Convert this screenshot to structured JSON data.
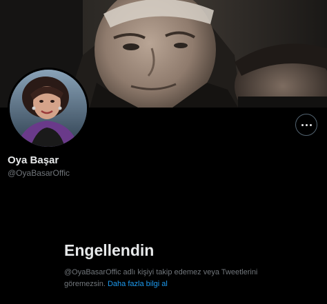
{
  "colors": {
    "background": "#000000",
    "primary_text": "#e7e9ea",
    "secondary_text": "#71767b",
    "link": "#1d9bf0",
    "button_border": "#536471"
  },
  "header": {
    "banner_icon": "banner-image",
    "more_icon": "more-horizontal-icon"
  },
  "profile": {
    "display_name": "Oya Başar",
    "username": "@OyaBasarOffic"
  },
  "blocked_notice": {
    "title": "Engellendin",
    "description": "@OyaBasarOffic adlı kişiyi takip edemez veya Tweetlerini göremezsin.",
    "link_label": "Daha fazla bilgi al"
  }
}
